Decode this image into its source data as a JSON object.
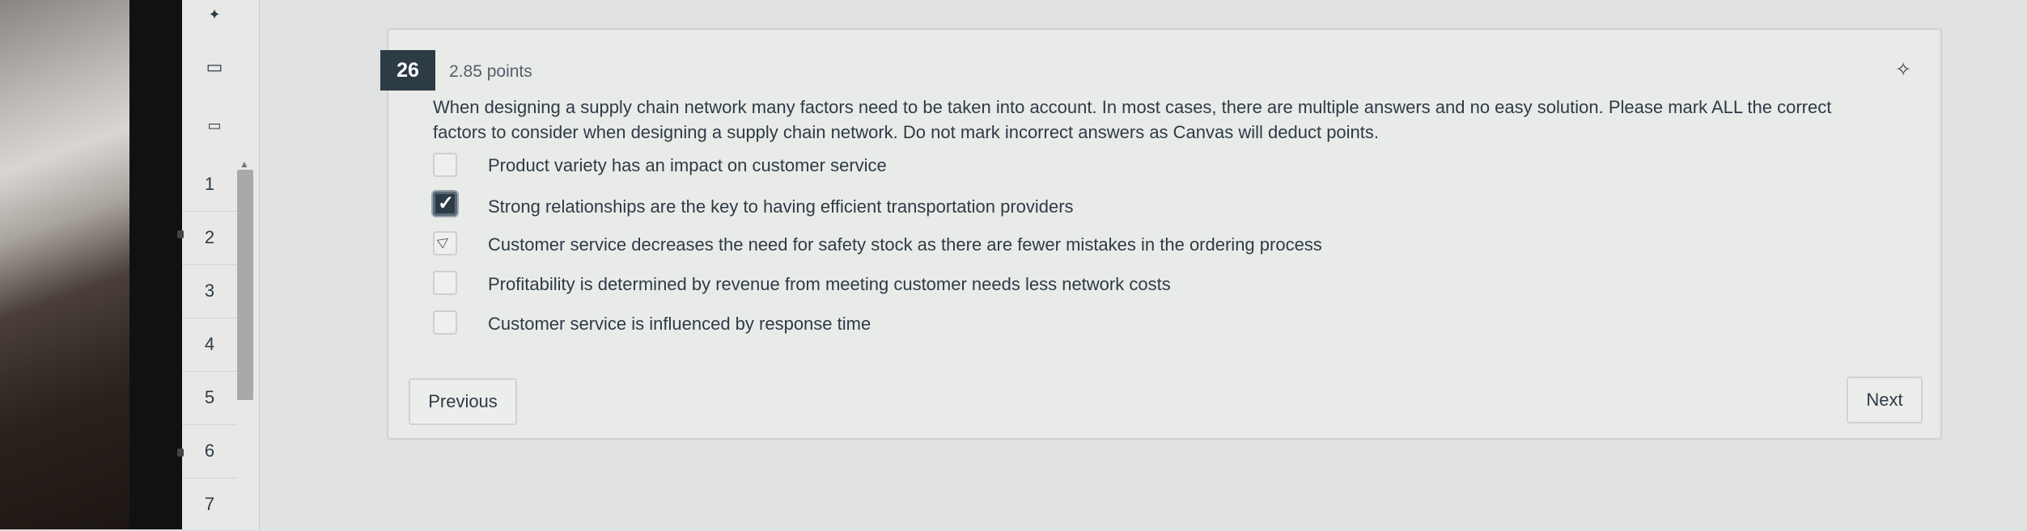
{
  "nav": {
    "items": [
      "1",
      "2",
      "3",
      "4",
      "5",
      "6",
      "7"
    ]
  },
  "question": {
    "number": "26",
    "points": "2.85 points",
    "text": "When designing a supply chain network many factors need to be taken into account.  In most cases, there are multiple answers and no easy solution.  Please mark ALL the correct factors to consider when designing a supply chain network.  Do not mark incorrect answers as Canvas will deduct points.",
    "options": [
      {
        "label": "Product variety has an impact on customer service",
        "checked": false
      },
      {
        "label": "Strong relationships are the key to having efficient transportation providers",
        "checked": true
      },
      {
        "label": "Customer service decreases the need for safety stock as there are fewer mistakes in the ordering process",
        "checked": false
      },
      {
        "label": "Profitability is determined by revenue from meeting customer needs less network costs",
        "checked": false
      },
      {
        "label": "Customer service is influenced by response time",
        "checked": false
      }
    ]
  },
  "buttons": {
    "previous": "Previous",
    "next": "Next"
  },
  "icons": {
    "pin": "pin-icon",
    "flag": "flag-icon",
    "bookmark": "bookmark-icon",
    "notes": "notes-icon"
  },
  "colors": {
    "accent": "#2d3b45",
    "background": "#e9ebe9"
  }
}
